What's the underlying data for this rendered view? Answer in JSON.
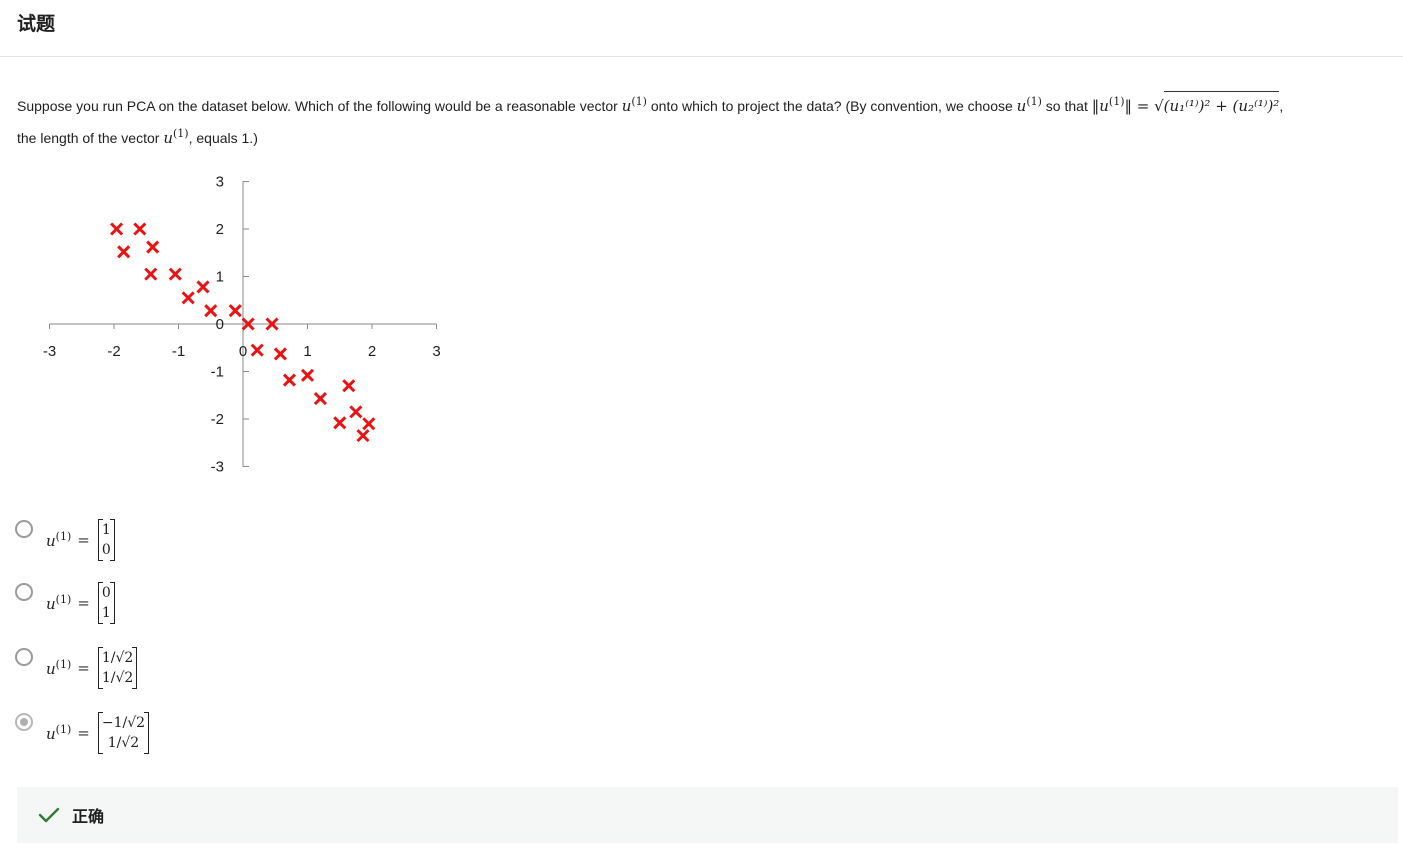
{
  "header": {
    "title": "试题"
  },
  "question": {
    "text_1": "Suppose you run PCA on the dataset below. Which of the following would be a reasonable vector ",
    "vector_symbol": "u",
    "superscript": "(1)",
    "text_2": " onto which to project the data? (By convention, we choose ",
    "text_3": " so that ",
    "norm_expr": "‖u",
    "norm_close": "‖ = ",
    "sqrt_expr": "(u₁⁽¹⁾)² + (u₂⁽¹⁾)²",
    "text_4": ",",
    "text_5": "the length of the vector ",
    "text_6": ", equals 1.)"
  },
  "chart_data": {
    "type": "scatter",
    "marker": "x",
    "marker_color": "#ee1111",
    "x_ticks": [
      "-3",
      "-2",
      "-1",
      "0",
      "1",
      "2",
      "3"
    ],
    "y_ticks": [
      "3",
      "2",
      "1",
      "0",
      "-1",
      "-2",
      "-3"
    ],
    "xlim": [
      -3,
      3
    ],
    "ylim": [
      -3,
      3
    ],
    "points": [
      [
        -1.96,
        2.0
      ],
      [
        -1.6,
        2.0
      ],
      [
        -1.85,
        1.52
      ],
      [
        -1.4,
        1.62
      ],
      [
        -1.43,
        1.05
      ],
      [
        -1.05,
        1.05
      ],
      [
        -0.85,
        0.55
      ],
      [
        -0.62,
        0.78
      ],
      [
        -0.5,
        0.28
      ],
      [
        -0.12,
        0.28
      ],
      [
        0.08,
        0.0
      ],
      [
        0.45,
        0.0
      ],
      [
        0.22,
        -0.55
      ],
      [
        0.58,
        -0.63
      ],
      [
        0.72,
        -1.18
      ],
      [
        1.0,
        -1.08
      ],
      [
        1.2,
        -1.57
      ],
      [
        1.64,
        -1.3
      ],
      [
        1.5,
        -2.08
      ],
      [
        1.75,
        -1.85
      ],
      [
        1.95,
        -2.1
      ],
      [
        1.86,
        -2.35
      ]
    ]
  },
  "options": [
    {
      "lhs": "u",
      "sup": "(1)",
      "eq": "=",
      "row1": "1",
      "row2": "0",
      "selected": false
    },
    {
      "lhs": "u",
      "sup": "(1)",
      "eq": "=",
      "row1": "0",
      "row2": "1",
      "selected": false
    },
    {
      "lhs": "u",
      "sup": "(1)",
      "eq": "=",
      "row1": "1/√2",
      "row2": "1/√2",
      "selected": false
    },
    {
      "lhs": "u",
      "sup": "(1)",
      "eq": "=",
      "row1": "−1/√2",
      "row2": "1/√2",
      "selected": true
    }
  ],
  "result": {
    "label": "正确",
    "icon": "check-icon",
    "color": "#2e7d32"
  }
}
